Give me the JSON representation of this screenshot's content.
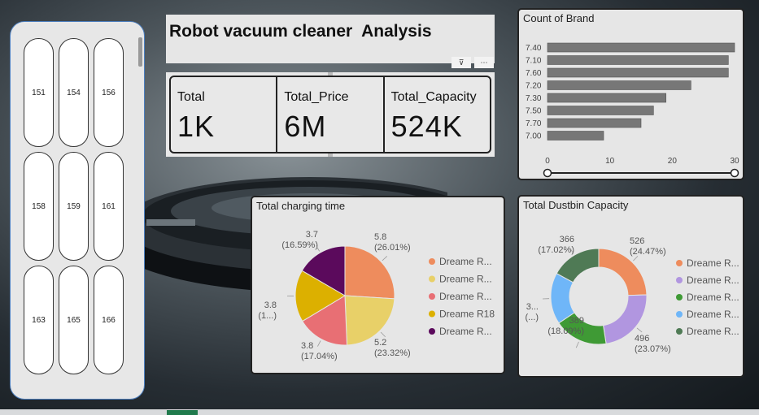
{
  "title": "Robot vacuum cleaner  Analysis",
  "slicer": {
    "items": [
      "151",
      "154",
      "156",
      "158",
      "159",
      "161",
      "163",
      "165",
      "166"
    ]
  },
  "kpis": [
    {
      "label": "Total",
      "value": "1K"
    },
    {
      "label": "Total_Price",
      "value": "6M"
    },
    {
      "label": "Total_Capacity",
      "value": "524K"
    }
  ],
  "colors": {
    "bar": "#777777",
    "orange": "#ee8c5d",
    "yellow": "#e8d068",
    "pink": "#e86f74",
    "gold": "#dcb000",
    "purple": "#5b0a5c",
    "lavender": "#b196e0",
    "green": "#3f9a35",
    "lightblue": "#6fb6f8",
    "darkgreen": "#4f7a55"
  },
  "chart_data": [
    {
      "type": "bar",
      "title": "Count of Brand",
      "categories": [
        "7.40",
        "7.10",
        "7.60",
        "7.20",
        "7.30",
        "7.50",
        "7.70",
        "7.00"
      ],
      "values": [
        30,
        29,
        29,
        23,
        19,
        17,
        15,
        9
      ],
      "xlim": [
        0,
        30
      ],
      "xticks": [
        "0",
        "10",
        "20",
        "30"
      ]
    },
    {
      "type": "pie",
      "title": "Total charging time",
      "slices": [
        {
          "label": "Dreame R...",
          "value": 5.8,
          "pct": "(26.01%)",
          "value_text": "5.8",
          "color": "#ee8c5d"
        },
        {
          "label": "Dreame R...",
          "value": 5.2,
          "pct": "(23.32%)",
          "value_text": "5.2",
          "color": "#e8d068"
        },
        {
          "label": "Dreame R...",
          "value": 3.8,
          "pct": "(17.04%)",
          "value_text": "3.8",
          "color": "#e86f74"
        },
        {
          "label": "Dreame R18",
          "value": 3.8,
          "pct": "(1...)",
          "value_text": "3.8",
          "color": "#dcb000"
        },
        {
          "label": "Dreame R...",
          "value": 3.7,
          "pct": "(16.59%)",
          "value_text": "3.7",
          "color": "#5b0a5c"
        }
      ]
    },
    {
      "type": "pie",
      "title": "Total Dustbin Capacity",
      "slices": [
        {
          "label": "Dreame R...",
          "value": 526,
          "pct": "(24.47%)",
          "value_text": "526",
          "color": "#ee8c5d"
        },
        {
          "label": "Dreame R...",
          "value": 496,
          "pct": "(23.07%)",
          "value_text": "496",
          "color": "#b196e0"
        },
        {
          "label": "Dreame R...",
          "value": 389,
          "pct": "(18.09%)",
          "value_text": "389",
          "color": "#3f9a35"
        },
        {
          "label": "Dreame R...",
          "value": 373,
          "pct": "(...)",
          "value_text": "3...",
          "color": "#6fb6f8"
        },
        {
          "label": "Dreame R...",
          "value": 366,
          "pct": "(17.02%)",
          "value_text": "366",
          "color": "#4f7a55"
        }
      ]
    }
  ]
}
